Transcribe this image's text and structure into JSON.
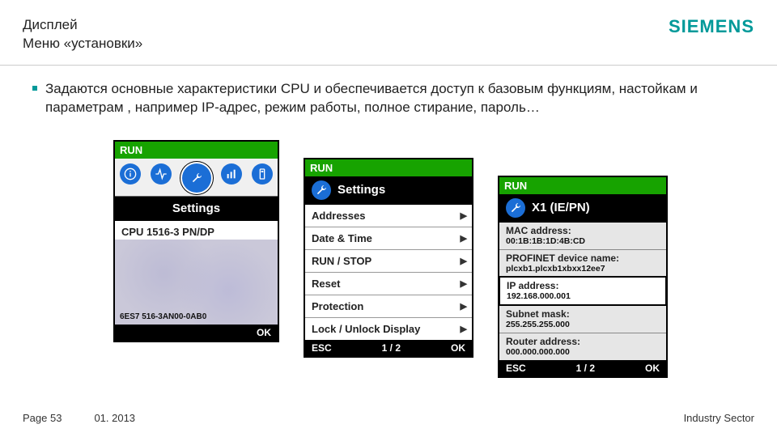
{
  "brand": "SIEMENS",
  "header_line1": "Дисплей",
  "header_line2": "Меню «установки»",
  "bullet_text": "Задаются основные  характеристики CPU и обеспечивается доступ к базовым функциям, настойкам и параметрам , например IP-адрес, режим работы, полное стирание, пароль…",
  "run_label": "RUN",
  "settings_label": "Settings",
  "screen1": {
    "model": "CPU 1516-3 PN/DP",
    "order_no": "6ES7 516-3AN00-0AB0",
    "ok": "OK"
  },
  "screen2": {
    "title": "Settings",
    "items": [
      "Addresses",
      "Date & Time",
      "RUN / STOP",
      "Reset",
      "Protection",
      "Lock / Unlock Display"
    ],
    "esc": "ESC",
    "page": "1 / 2",
    "ok": "OK"
  },
  "screen3": {
    "title": "X1 (IE/PN)",
    "rows": [
      {
        "k": "MAC address:",
        "v": "00:1B:1B:1D:4B:CD"
      },
      {
        "k": "PROFINET device name:",
        "v": "plcxb1.plcxb1xbxx12ee7"
      },
      {
        "k": "IP address:",
        "v": "192.168.000.001"
      },
      {
        "k": "Subnet mask:",
        "v": "255.255.255.000"
      },
      {
        "k": "Router address:",
        "v": "000.000.000.000"
      }
    ],
    "selected_index": 2,
    "esc": "ESC",
    "page": "1 / 2",
    "ok": "OK"
  },
  "footer": {
    "page": "Page 53",
    "date": "01. 2013",
    "sector": "Industry Sector"
  },
  "icons": {
    "info": "info-icon",
    "diag": "activity-icon",
    "wrench": "wrench-icon",
    "bars": "bars-icon",
    "device": "device-icon"
  }
}
